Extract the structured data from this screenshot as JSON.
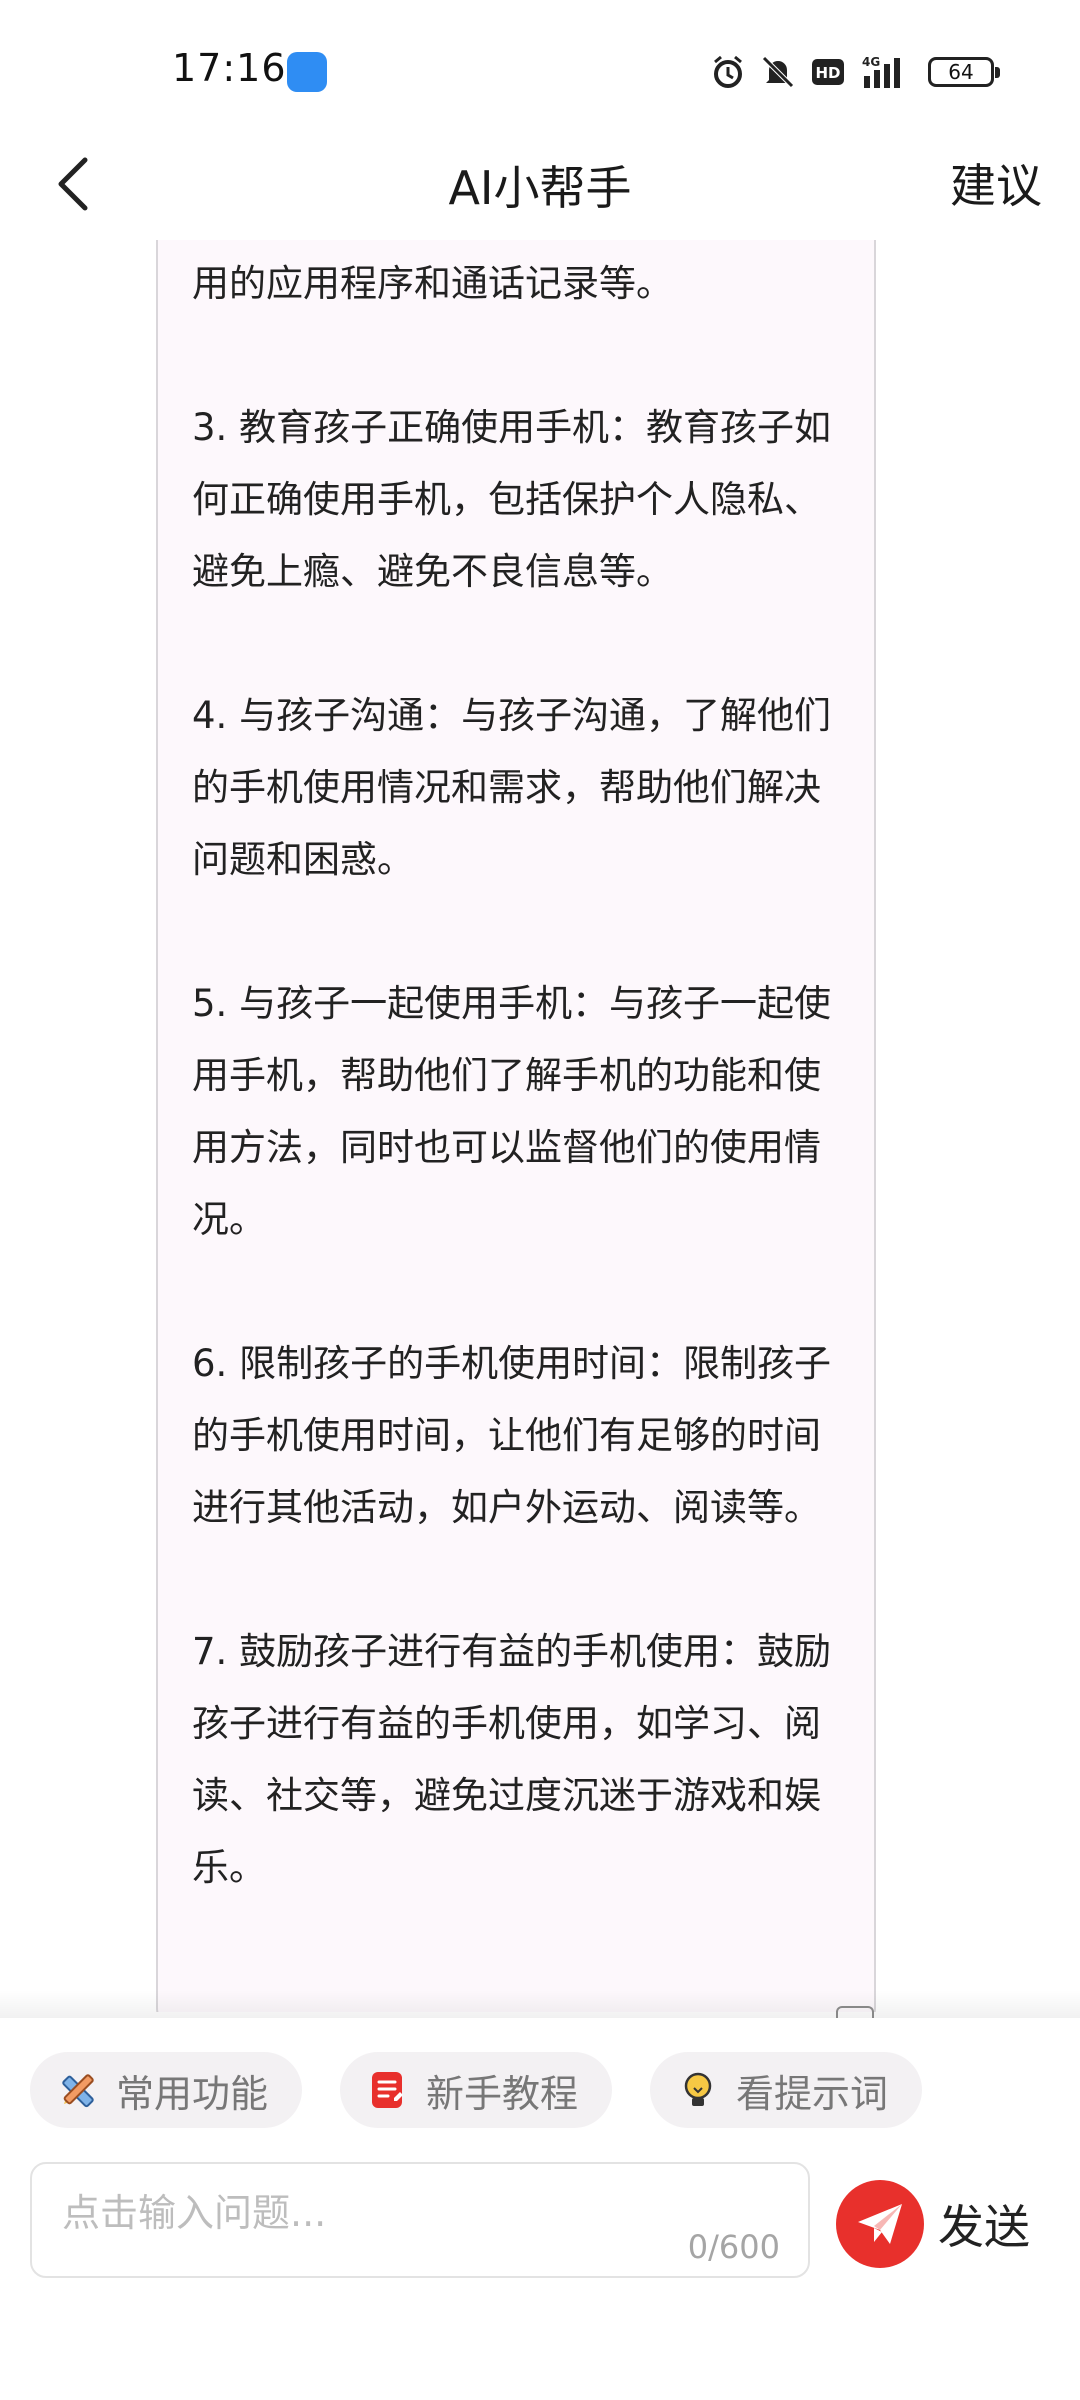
{
  "status_bar": {
    "time": "17:16",
    "battery": "64",
    "network": "4G"
  },
  "nav": {
    "title": "AI小帮手",
    "suggest_label": "建议"
  },
  "message": {
    "paragraphs": [
      "用的应用程序和通话记录等。",
      "3. 教育孩子正确使用手机：教育孩子如何正确使用手机，包括保护个人隐私、避免上瘾、避免不良信息等。",
      "4. 与孩子沟通：与孩子沟通，了解他们的手机使用情况和需求，帮助他们解决问题和困惑。",
      "5. 与孩子一起使用手机：与孩子一起使用手机，帮助他们了解手机的功能和使用方法，同时也可以监督他们的使用情况。",
      "6. 限制孩子的手机使用时间：限制孩子的手机使用时间，让他们有足够的时间进行其他活动，如户外运动、阅读等。",
      "7. 鼓励孩子进行有益的手机使用：鼓励孩子进行有益的手机使用，如学习、阅读、社交等，避免过度沉迷于游戏和娱乐。"
    ]
  },
  "chips": {
    "common": "常用功能",
    "tutorial": "新手教程",
    "tips": "看提示词"
  },
  "input": {
    "placeholder": "点击输入问题...",
    "value": "",
    "count": "0/600"
  },
  "send_label": "发送",
  "colors": {
    "accent_red": "#e8302c",
    "bubble_bg": "#fdf8fc",
    "chip_bg": "#f3f1f3"
  },
  "icons": {
    "back": "chevron-left-icon",
    "common": "pencil-ruler-icon",
    "tutorial": "document-icon",
    "tips": "lightbulb-icon",
    "send": "paper-plane-icon"
  }
}
